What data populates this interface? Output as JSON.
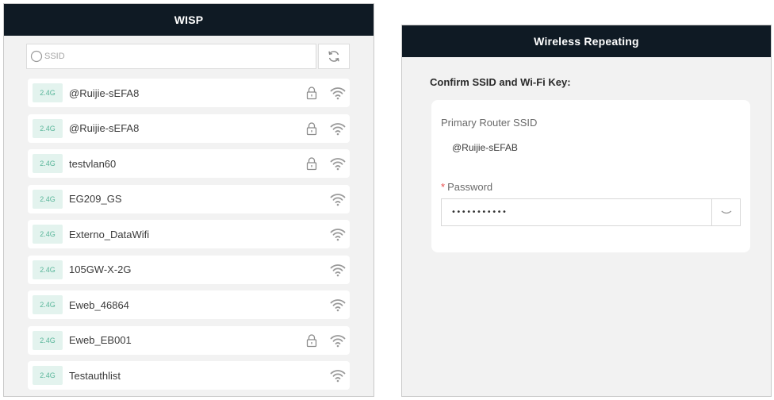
{
  "wisp": {
    "title": "WISP",
    "search": {
      "placeholder": "SSID",
      "value": ""
    },
    "refresh_icon": "refresh-icon",
    "networks": [
      {
        "band": "2.4G",
        "ssid": "@Ruijie-sEFA8",
        "locked": true
      },
      {
        "band": "2.4G",
        "ssid": "@Ruijie-sEFA8",
        "locked": true
      },
      {
        "band": "2.4G",
        "ssid": "testvlan60",
        "locked": true
      },
      {
        "band": "2.4G",
        "ssid": "EG209_GS",
        "locked": false
      },
      {
        "band": "2.4G",
        "ssid": "Externo_DataWifi",
        "locked": false
      },
      {
        "band": "2.4G",
        "ssid": "105GW-X-2G",
        "locked": false
      },
      {
        "band": "2.4G",
        "ssid": "Eweb_46864",
        "locked": false
      },
      {
        "band": "2.4G",
        "ssid": "Eweb_EB001",
        "locked": true
      },
      {
        "band": "2.4G",
        "ssid": "Testauthlist",
        "locked": false
      }
    ]
  },
  "repeating": {
    "title": "Wireless Repeating",
    "confirm_title": "Confirm SSID and Wi-Fi Key:",
    "primary_ssid_label": "Primary Router SSID",
    "primary_ssid_value": "@Ruijie-sEFAB",
    "password_required_mark": "*",
    "password_label": "Password",
    "password_value": "•••••••••••"
  },
  "colors": {
    "header_bg": "#0f1a24",
    "badge_bg": "#e3f3ee",
    "badge_text": "#59b69a",
    "required": "#e84a4a"
  }
}
